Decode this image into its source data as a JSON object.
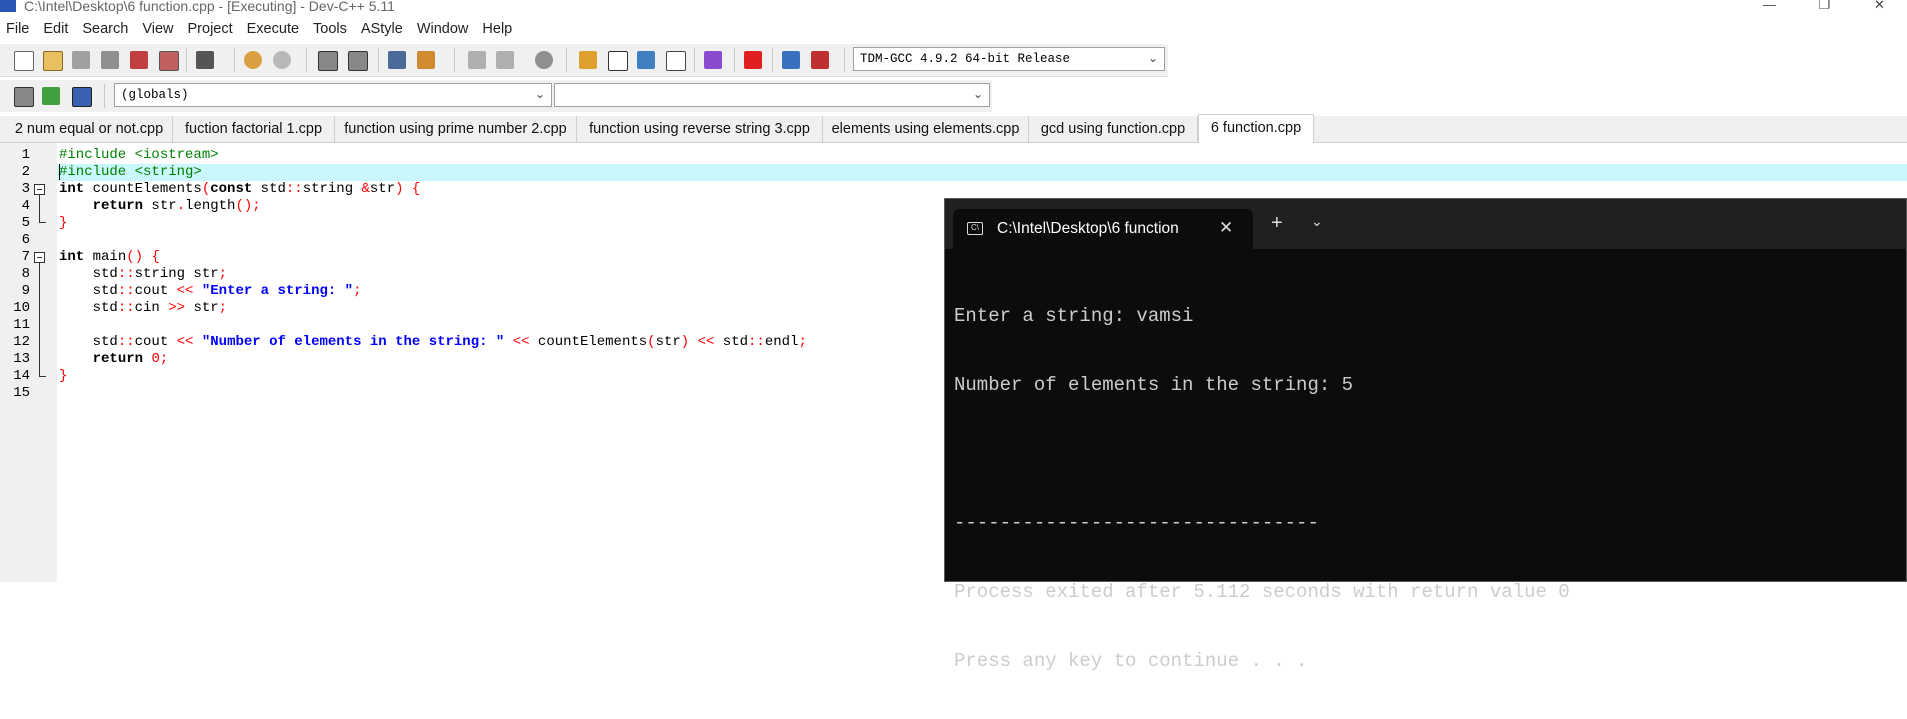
{
  "window": {
    "title": "C:\\Intel\\Desktop\\6 function.cpp - [Executing] - Dev-C++ 5.11",
    "controls": [
      "—",
      "❐",
      "✕"
    ]
  },
  "menu": [
    "File",
    "Edit",
    "Search",
    "View",
    "Project",
    "Execute",
    "Tools",
    "AStyle",
    "Window",
    "Help"
  ],
  "toolbar": {
    "compiler": "TDM-GCC 4.9.2 64-bit Release",
    "scope": "(globals)",
    "symbol": ""
  },
  "tabs": [
    "2 num equal or not.cpp",
    "fuction factorial 1.cpp",
    "function using prime number 2.cpp",
    "function using reverse string 3.cpp",
    "elements using elements.cpp",
    "gcd using function.cpp",
    "6 function.cpp"
  ],
  "active_tab": "6 function.cpp",
  "editor": {
    "line_numbers": [
      "1",
      "2",
      "3",
      "4",
      "5",
      "6",
      "7",
      "8",
      "9",
      "10",
      "11",
      "12",
      "13",
      "14",
      "15"
    ],
    "highlighted_line": 2,
    "lines": [
      [
        {
          "t": "pp",
          "v": "#include <iostream>"
        }
      ],
      [
        {
          "t": "pp",
          "v": "#include <string>"
        }
      ],
      [
        {
          "t": "kw",
          "v": "int"
        },
        {
          "t": "tx",
          "v": " countElements"
        },
        {
          "t": "op",
          "v": "("
        },
        {
          "t": "kw",
          "v": "const"
        },
        {
          "t": "tx",
          "v": " std"
        },
        {
          "t": "op",
          "v": "::"
        },
        {
          "t": "tx",
          "v": "string "
        },
        {
          "t": "op",
          "v": "&"
        },
        {
          "t": "tx",
          "v": "str"
        },
        {
          "t": "op",
          "v": ") {"
        }
      ],
      [
        {
          "t": "tx",
          "v": "    "
        },
        {
          "t": "kw",
          "v": "return"
        },
        {
          "t": "tx",
          "v": " str"
        },
        {
          "t": "op",
          "v": "."
        },
        {
          "t": "tx",
          "v": "length"
        },
        {
          "t": "op",
          "v": "();"
        }
      ],
      [
        {
          "t": "op",
          "v": "}"
        }
      ],
      [],
      [
        {
          "t": "kw",
          "v": "int"
        },
        {
          "t": "tx",
          "v": " main"
        },
        {
          "t": "op",
          "v": "() {"
        }
      ],
      [
        {
          "t": "tx",
          "v": "    std"
        },
        {
          "t": "op",
          "v": "::"
        },
        {
          "t": "tx",
          "v": "string str"
        },
        {
          "t": "op",
          "v": ";"
        }
      ],
      [
        {
          "t": "tx",
          "v": "    std"
        },
        {
          "t": "op",
          "v": "::"
        },
        {
          "t": "tx",
          "v": "cout "
        },
        {
          "t": "op",
          "v": "<<"
        },
        {
          "t": "tx",
          "v": " "
        },
        {
          "t": "st",
          "v": "\"Enter a string: \""
        },
        {
          "t": "op",
          "v": ";"
        }
      ],
      [
        {
          "t": "tx",
          "v": "    std"
        },
        {
          "t": "op",
          "v": "::"
        },
        {
          "t": "tx",
          "v": "cin "
        },
        {
          "t": "op",
          "v": ">>"
        },
        {
          "t": "tx",
          "v": " str"
        },
        {
          "t": "op",
          "v": ";"
        }
      ],
      [],
      [
        {
          "t": "tx",
          "v": "    std"
        },
        {
          "t": "op",
          "v": "::"
        },
        {
          "t": "tx",
          "v": "cout "
        },
        {
          "t": "op",
          "v": "<<"
        },
        {
          "t": "tx",
          "v": " "
        },
        {
          "t": "st",
          "v": "\"Number of elements in the string: \""
        },
        {
          "t": "tx",
          "v": " "
        },
        {
          "t": "op",
          "v": "<<"
        },
        {
          "t": "tx",
          "v": " countElements"
        },
        {
          "t": "op",
          "v": "("
        },
        {
          "t": "tx",
          "v": "str"
        },
        {
          "t": "op",
          "v": ")"
        },
        {
          "t": "tx",
          "v": " "
        },
        {
          "t": "op",
          "v": "<<"
        },
        {
          "t": "tx",
          "v": " std"
        },
        {
          "t": "op",
          "v": "::"
        },
        {
          "t": "tx",
          "v": "endl"
        },
        {
          "t": "op",
          "v": ";"
        }
      ],
      [
        {
          "t": "tx",
          "v": "    "
        },
        {
          "t": "kw",
          "v": "return"
        },
        {
          "t": "tx",
          "v": " "
        },
        {
          "t": "nu",
          "v": "0"
        },
        {
          "t": "op",
          "v": ";"
        }
      ],
      [
        {
          "t": "op",
          "v": "}"
        }
      ],
      []
    ]
  },
  "terminal": {
    "tab_title": "C:\\Intel\\Desktop\\6 function",
    "close": "✕",
    "new_tab": "+",
    "dropdown": "⌄",
    "icon_glyph": "C\\",
    "output": [
      "Enter a string: vamsi",
      "Number of elements in the string: 5",
      "",
      "--------------------------------",
      "Process exited after 5.112 seconds with return value 0",
      "Press any key to continue . . ."
    ]
  },
  "colors": {
    "preprocessor": "#008000",
    "operator": "#ff0000",
    "string": "#0000ff",
    "line_highlight": "#c9f7fb",
    "terminal_bg": "#0c0c0c",
    "terminal_text": "#cccccc"
  }
}
